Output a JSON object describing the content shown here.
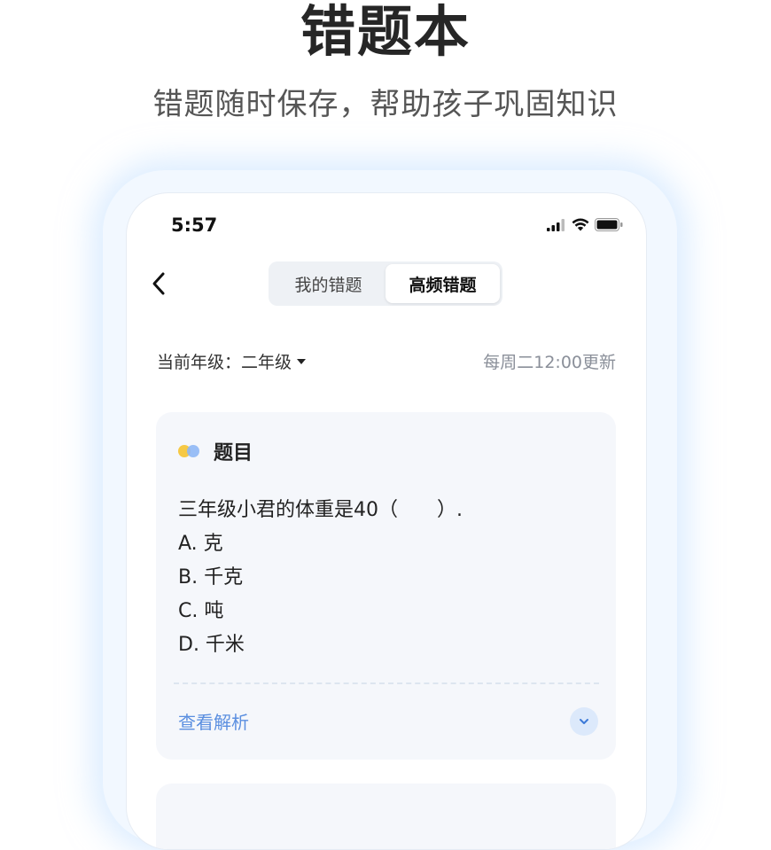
{
  "hero": {
    "title": "错题本",
    "subtitle": "错题随时保存，帮助孩子巩固知识"
  },
  "status_bar": {
    "time": "5:57",
    "icons": [
      "signal-icon",
      "wifi-icon",
      "battery-icon"
    ]
  },
  "nav": {
    "back_icon": "chevron-left-icon",
    "tabs": [
      {
        "label": "我的错题",
        "active": false
      },
      {
        "label": "高频错题",
        "active": true
      }
    ]
  },
  "filter": {
    "grade_label": "当前年级：二年级",
    "update_note": "每周二12:00更新"
  },
  "question_card": {
    "title": "题目",
    "question": "三年级小君的体重是40（　　）.",
    "options": [
      "A. 克",
      "B. 千克",
      "C. 吨",
      "D. 千米"
    ],
    "analysis_label": "查看解析",
    "expand_icon": "chevron-down-icon"
  },
  "colors": {
    "accent": "#5b8fe0",
    "card_bg": "#f5f7fb",
    "dot_yellow": "#f6c945",
    "dot_blue": "#8fb7f5"
  }
}
